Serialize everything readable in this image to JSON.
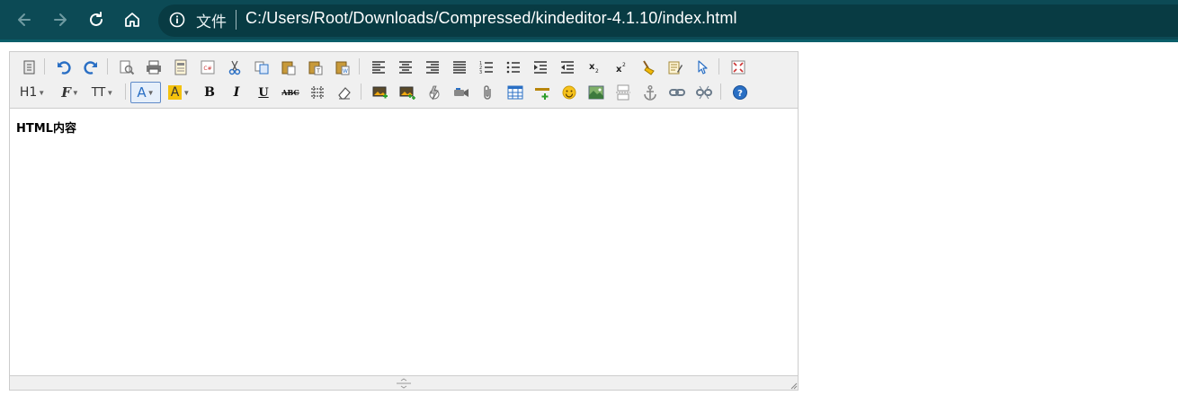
{
  "browser": {
    "file_label": "文件",
    "url": "C:/Users/Root/Downloads/Compressed/kindeditor-4.1.10/index.html"
  },
  "editor": {
    "content": "HTML内容",
    "toolbar": {
      "heading_label": "H1",
      "font_name_label": "F",
      "font_size_label": "TT",
      "forecolor_label": "A",
      "hilitecolor_label": "A",
      "bold_label": "B",
      "italic_label": "I",
      "underline_label": "U",
      "strike_label": "ABC"
    }
  },
  "colors": {
    "browser_bg": "#0c4a55",
    "address_bg": "#083b43",
    "toolbar_bg": "#f0f0f0",
    "border": "#cccccc",
    "icon_blue": "#2a6fc4",
    "highlight_yellow": "#f4c20d"
  }
}
